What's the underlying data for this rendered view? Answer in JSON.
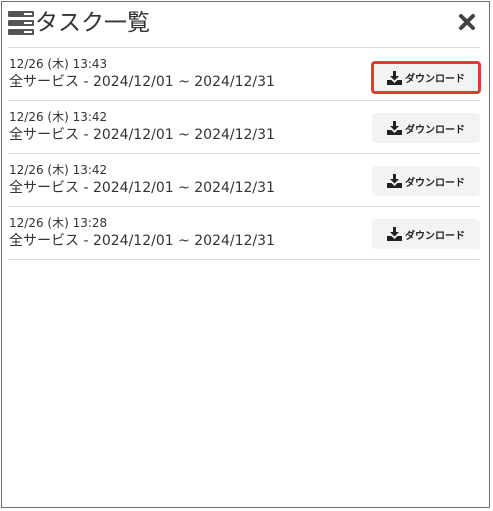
{
  "header": {
    "title": "タスク一覧"
  },
  "tasks": [
    {
      "timestamp": "12/26 (木) 13:43",
      "description": "全サービス - 2024/12/01 ~ 2024/12/31",
      "button_label": "ダウンロード"
    },
    {
      "timestamp": "12/26 (木) 13:42",
      "description": "全サービス - 2024/12/01 ~ 2024/12/31",
      "button_label": "ダウンロード"
    },
    {
      "timestamp": "12/26 (木) 13:42",
      "description": "全サービス - 2024/12/01 ~ 2024/12/31",
      "button_label": "ダウンロード"
    },
    {
      "timestamp": "12/26 (木) 13:28",
      "description": "全サービス - 2024/12/01 ~ 2024/12/31",
      "button_label": "ダウンロード"
    }
  ],
  "icons": {
    "header": "task-list-icon",
    "close": "close-icon",
    "download": "download-icon"
  },
  "colors": {
    "highlight": "#e53935",
    "button_bg": "#f1f3f5",
    "divider": "#dcdcdc"
  }
}
